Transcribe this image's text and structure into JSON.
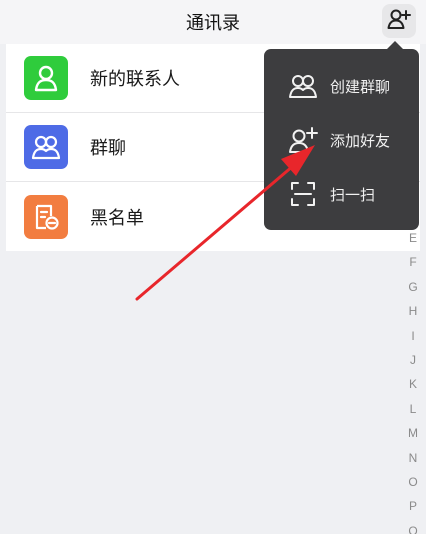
{
  "header": {
    "title": "通讯录",
    "add_icon": "add-contact-icon"
  },
  "list": {
    "items": [
      {
        "label": "新的联系人",
        "icon": "new-contact-icon",
        "color": "#2fcc3c"
      },
      {
        "label": "群聊",
        "icon": "group-chat-icon",
        "color": "#4e6be6"
      },
      {
        "label": "黑名单",
        "icon": "blacklist-icon",
        "color": "#f27d40"
      }
    ]
  },
  "popup_menu": {
    "items": [
      {
        "label": "创建群聊",
        "icon": "group-chat-icon"
      },
      {
        "label": "添加好友",
        "icon": "add-friend-icon"
      },
      {
        "label": "扫一扫",
        "icon": "scan-icon"
      }
    ]
  },
  "index_bar": {
    "letters": [
      "E",
      "F",
      "G",
      "H",
      "I",
      "J",
      "K",
      "L",
      "M",
      "N",
      "O",
      "P",
      "Q"
    ]
  },
  "annotation": {
    "arrow_color": "#e8262b",
    "arrow_icon": "red-arrow-annotation"
  }
}
